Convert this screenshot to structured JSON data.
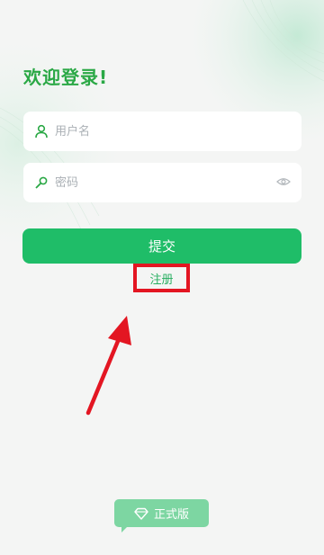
{
  "login": {
    "title": "欢迎登录!",
    "username_placeholder": "用户名",
    "password_placeholder": "密码",
    "submit_label": "提交",
    "register_label": "注册"
  },
  "footer": {
    "version_label": "正式版"
  },
  "colors": {
    "brand_green": "#1fbd68",
    "title_green": "#2aa845",
    "highlight_red": "#e31622"
  }
}
